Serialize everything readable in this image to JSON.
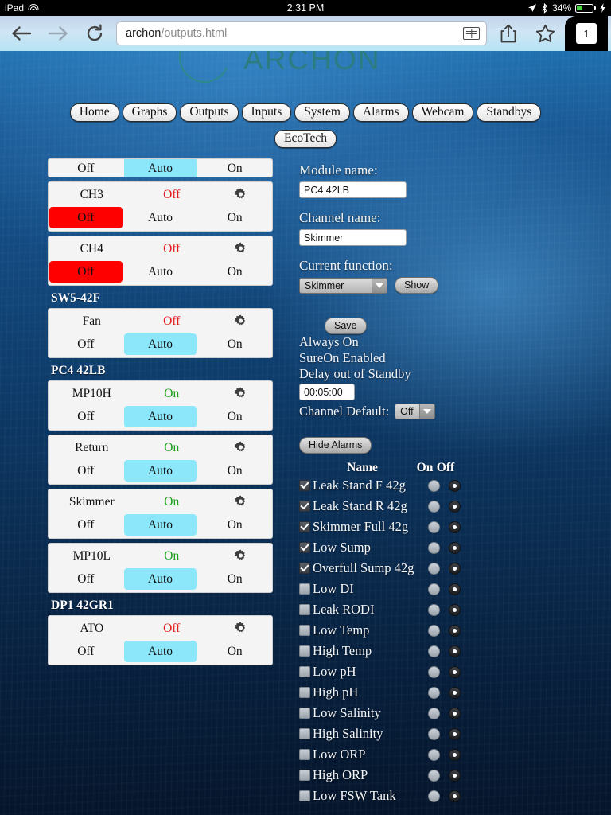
{
  "statusbar": {
    "device": "iPad",
    "time": "2:31 PM",
    "battery_percent": "34%"
  },
  "toolbar": {
    "url_host": "archon",
    "url_path": "/outputs.html",
    "tab_count": "1"
  },
  "site": {
    "logo": "ARCHON",
    "nav": [
      {
        "label": "Home"
      },
      {
        "label": "Graphs"
      },
      {
        "label": "Outputs"
      },
      {
        "label": "Inputs"
      },
      {
        "label": "System"
      },
      {
        "label": "Alarms"
      },
      {
        "label": "Webcam"
      },
      {
        "label": "Standbys"
      }
    ],
    "nav2": [
      {
        "label": "EcoTech"
      }
    ]
  },
  "outputs": {
    "seg_labels": {
      "off": "Off",
      "auto": "Auto",
      "on": "On"
    },
    "blocks": [
      {
        "group": null,
        "cards": [
          {
            "partial_top": true,
            "name": "",
            "state": "",
            "state_class": "",
            "selected": "auto"
          }
        ]
      },
      {
        "group": null,
        "cards": [
          {
            "name": "CH3",
            "state": "Off",
            "state_class": "off",
            "selected": "off"
          },
          {
            "name": "CH4",
            "state": "Off",
            "state_class": "off",
            "selected": "off"
          }
        ]
      },
      {
        "group": "SW5-42F",
        "cards": [
          {
            "name": "Fan",
            "state": "Off",
            "state_class": "off",
            "selected": "auto"
          }
        ]
      },
      {
        "group": "PC4 42LB",
        "cards": [
          {
            "name": "MP10H",
            "state": "On",
            "state_class": "on",
            "selected": "auto"
          },
          {
            "name": "Return",
            "state": "On",
            "state_class": "on",
            "selected": "auto"
          },
          {
            "name": "Skimmer",
            "state": "On",
            "state_class": "on",
            "selected": "auto"
          },
          {
            "name": "MP10L",
            "state": "On",
            "state_class": "on",
            "selected": "auto"
          }
        ]
      },
      {
        "group": "DP1 42GR1",
        "cards": [
          {
            "name": "ATO",
            "state": "Off",
            "state_class": "off",
            "selected": "auto"
          }
        ]
      }
    ]
  },
  "detail": {
    "module_name_label": "Module name:",
    "module_name_value": "PC4 42LB",
    "channel_name_label": "Channel name:",
    "channel_name_value": "Skimmer",
    "current_function_label": "Current function:",
    "current_function_value": "Skimmer",
    "show_button": "Show",
    "save_button": "Save",
    "always_on": "Always On",
    "sureon_enabled": "SureOn Enabled",
    "delay_out_of_standby": "Delay out of Standby",
    "delay_value": "00:05:00",
    "channel_default_label": "Channel Default:",
    "channel_default_value": "Off",
    "hide_alarms_button": "Hide Alarms"
  },
  "alarms": {
    "header": {
      "name": "Name",
      "on": "On",
      "off": "Off"
    },
    "rows": [
      {
        "name": "Leak Stand F 42g",
        "checked": true,
        "state": "off"
      },
      {
        "name": "Leak Stand R 42g",
        "checked": true,
        "state": "off"
      },
      {
        "name": "Skimmer Full 42g",
        "checked": true,
        "state": "off"
      },
      {
        "name": "Low Sump",
        "checked": true,
        "state": "off"
      },
      {
        "name": "Overfull Sump 42g",
        "checked": true,
        "state": "off"
      },
      {
        "name": "Low DI",
        "checked": false,
        "state": "off"
      },
      {
        "name": "Leak RODI",
        "checked": false,
        "state": "off"
      },
      {
        "name": "Low Temp",
        "checked": false,
        "state": "off"
      },
      {
        "name": "High Temp",
        "checked": false,
        "state": "off"
      },
      {
        "name": "Low pH",
        "checked": false,
        "state": "off"
      },
      {
        "name": "High pH",
        "checked": false,
        "state": "off"
      },
      {
        "name": "Low Salinity",
        "checked": false,
        "state": "off"
      },
      {
        "name": "High Salinity",
        "checked": false,
        "state": "off"
      },
      {
        "name": "Low ORP",
        "checked": false,
        "state": "off"
      },
      {
        "name": "High ORP",
        "checked": false,
        "state": "off"
      },
      {
        "name": "Low FSW Tank",
        "checked": false,
        "state": "off"
      }
    ]
  },
  "colors": {
    "auto_selected": "#8ce7fb",
    "off_selected": "#fe0000",
    "state_on": "#18a018",
    "state_off": "#e21b1b",
    "logo": "#2c7d82"
  }
}
